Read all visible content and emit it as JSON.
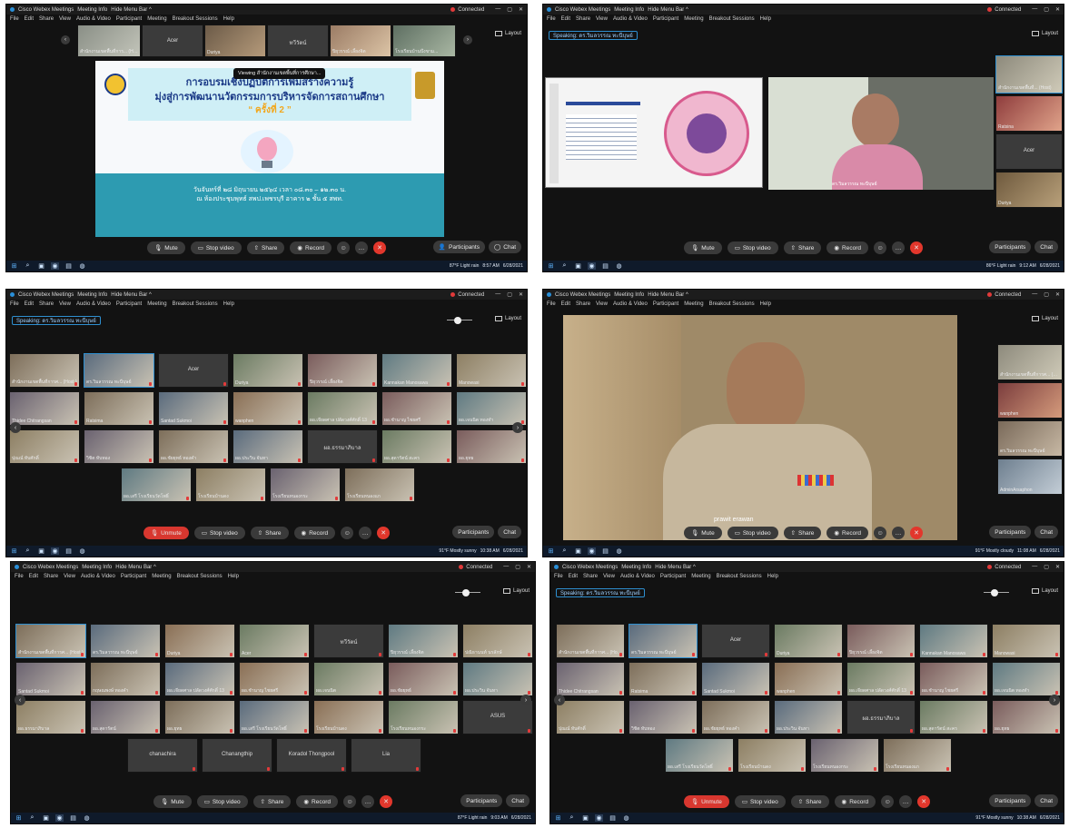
{
  "app": {
    "window_title": "Cisco Webex Meetings",
    "meeting_info": "Meeting Info",
    "hide_menu": "Hide Menu Bar ^",
    "connected": "Connected",
    "menu": [
      "File",
      "Edit",
      "Share",
      "View",
      "Audio & Video",
      "Participant",
      "Meeting",
      "Breakout Sessions",
      "Help"
    ],
    "layout": "Layout"
  },
  "controls": {
    "mute": "Mute",
    "unmute": "Unmute",
    "stop_video": "Stop video",
    "share": "Share",
    "record": "Record",
    "participants": "Participants",
    "chat": "Chat"
  },
  "taskbar_times": {
    "s1": {
      "weather": "87°F Light rain",
      "time": "8:57 AM",
      "date": "6/28/2021"
    },
    "s2": {
      "weather": "86°F Light rain",
      "time": "9:12 AM",
      "date": "6/28/2021"
    },
    "s3": {
      "weather": "91°F Mostly sunny",
      "time": "10:38 AM",
      "date": "6/28/2021"
    },
    "s4": {
      "weather": "91°F Mostly cloudy",
      "time": "11:08 AM",
      "date": "6/28/2021"
    },
    "s5": {
      "weather": "87°F Light rain",
      "time": "9:03 AM",
      "date": "6/28/2021"
    },
    "s6": {
      "weather": "91°F Mostly sunny",
      "time": "10:38 AM",
      "date": "6/28/2021"
    }
  },
  "speaking": "Speaking: ดร.วิมลวรรณ ทะนืบุษย์",
  "slide": {
    "viewing": "Viewing สำนักงานเขตพื้นที่การศึกษา...",
    "title1": "การอบรมเชิงปฏิบัติการเพิ่มสร้างความรู้",
    "title2": "มุ่งสู่การพัฒนานวัตกรรมการบริหารจัดการสถานศึกษา",
    "title3": "“ ครั้งที่ 2 ”",
    "date_line": "วันจันทร์ที่ ๒๘ มิถุนายน ๒๕๖๔ เวลา ๐๘.๓๐ – ๑๒.๓๐ น.",
    "place_line": "ณ ห้องประชุมพุทธ์ สพป.เพชรบุรี อาคาร ๒ ชั้น ๕ สพท."
  },
  "s1_strip": [
    "สำนักงานเขตพื้นที่การ... (Host,)",
    "Acer",
    "Duriya",
    "ทวีวัตน์",
    "ปิยุวรรณ์ เลี้ยงจิต",
    "โรงเรียนบ้านบึงขาม..."
  ],
  "s2_side": [
    "สำนักงานเขตพื้นที่... (Host)",
    "Ratsina",
    "Acer",
    "Duriya"
  ],
  "s2_presenter": "ดร.วิมลวรรณ ทะนืบุษย์",
  "s3_names": [
    "สำนักงานเขตพื้นที่การศ... (Host,)",
    "ดร.วิมลวรรณ ทะนืบุษย์",
    "Acer",
    "Duriya",
    "ปิยุวรรณ์ เลี้ยงจิต",
    "Kannakan Manosawa",
    "Manowasi",
    "Thidee Chitrangsan",
    "Ratsima",
    "Santad Sukmoi",
    "wanphen",
    "ผอ.เจียดศาล ปลัดวงศ์ศักดิ์ 13",
    "ผอ.ชำนาญ ไชยศรี",
    "ผอ.เจนนิต ทองทำ",
    "ปุณณ์ ทับศักดิ์",
    "วิชิต ทับทอง",
    "ผอ.ชัยยุทธ์ ทองคำ",
    "ผอ.ประวิน จันทา",
    "ผอ.ธรรมาภิบาล",
    "ผอ.สุดารัตน์ สะคร",
    "ผอ.ยุทธ",
    "ผอ.เสรี โรงเรียนวัดโพธิ์",
    "โรงเรียนบ้านดง",
    "โรงเรียนหนองกระ",
    "โรงเรียนหนองแก"
  ],
  "s4_speaker": "prawit erawan",
  "s4_side": [
    "สำนักงานเขตพื้นที่การศ... (Host,)",
    "wanphen",
    "ดร.วิมลวรรณ ทะนืบุษย์",
    "AdminArsaphon"
  ],
  "s5_names": [
    "สำนักงานเขตพื้นที่การศ... (Host,)",
    "ดร.วิมลวรรณ ทะนืบุษย์",
    "Duriya",
    "Acer",
    "ทวีวัตน์",
    "ปิยุวรรณ์ เลี้ยงจิต",
    "ปณิธานนท์ นรลักษ์",
    "Santad Sukmoi",
    "กฤษณพงษ์ ทองคำ",
    "ผอ.เจียดศาล ปลัดวงศ์ศักดิ์ 13",
    "ผอ.ชำนาญ ไชยศรี",
    "ผอ.เจนนิต",
    "ผอ.ชัยยุทธ์",
    "ผอ.ประวิน จันทา",
    "ผอ.ธรรมาภิบาล",
    "ผอ.สุดารัตน์",
    "ผอ.ยุทธ",
    "ผอ.เสรี โรงเรียนวัดโพธิ์",
    "โรงเรียนบ้านดง",
    "โรงเรียนหนองกระ",
    "ASUS",
    "chanachira",
    "Chanangthip",
    "Koradol Thongpool",
    "Lia"
  ],
  "s6_names": [
    "สำนักงานเขตพื้นที่การศ... (Host,)",
    "ดร.วิมลวรรณ ทะนืบุษย์",
    "Acer",
    "Duriya",
    "ปิยุวรรณ์ เลี้ยงจิต",
    "Kannakan Manosawa",
    "Manowasi",
    "Thidee Chitrangsan",
    "Ratsima",
    "Santad Sukmoi",
    "wanphen",
    "ผอ.เจียดศาล ปลัดวงศ์ศักดิ์ 13",
    "ผอ.ชำนาญ ไชยศรี",
    "ผอ.เจนนิต ทองทำ",
    "ปุณณ์ ทับศักดิ์",
    "วิชิต ทับทอง",
    "ผอ.ชัยยุทธ์ ทองคำ",
    "ผอ.ประวิน จันทา",
    "ผอ.ธรรมาภิบาล",
    "ผอ.สุดารัตน์ สะคร",
    "ผอ.ยุทธ",
    "ผอ.เสรี โรงเรียนวัดโพธิ์",
    "โรงเรียนบ้านดง",
    "โรงเรียนหนองกระ",
    "โรงเรียนหนองแก"
  ],
  "icons": {
    "mute": "mic-icon",
    "video": "camera-icon",
    "share": "share-icon",
    "record": "record-icon",
    "end": "end-call-icon"
  },
  "colors": {
    "accent": "#2e8fd0",
    "end_call": "#e2372c",
    "background": "#121212",
    "slide_title": "#1b3a87",
    "slide_band": "#2d9bb1"
  }
}
